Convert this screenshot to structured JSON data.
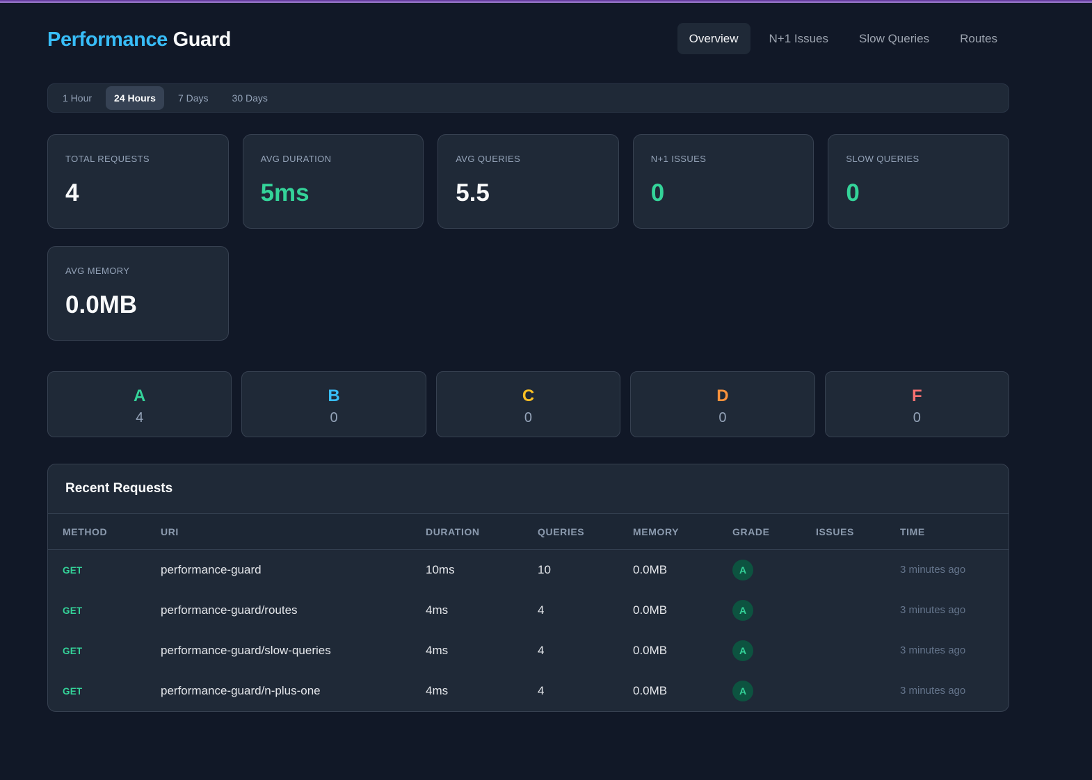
{
  "colors": {
    "page_bg": "#111827",
    "card_bg": "#1f2937",
    "card_border": "#374151",
    "blue": "#38bdf8",
    "green": "#34d399",
    "amber": "#fbbf24",
    "orange": "#fb923c",
    "red": "#f87171",
    "topbar_purple": "#8b5cf6"
  },
  "header": {
    "title_accent": "Performance",
    "title_rest": "Guard",
    "nav": [
      {
        "label": "Overview",
        "active": true
      },
      {
        "label": "N+1 Issues",
        "active": false
      },
      {
        "label": "Slow Queries",
        "active": false
      },
      {
        "label": "Routes",
        "active": false
      }
    ]
  },
  "time_range": [
    {
      "label": "1 Hour",
      "active": false
    },
    {
      "label": "24 Hours",
      "active": true
    },
    {
      "label": "7 Days",
      "active": false
    },
    {
      "label": "30 Days",
      "active": false
    }
  ],
  "stats": [
    {
      "label": "TOTAL REQUESTS",
      "value": "4",
      "color": "default"
    },
    {
      "label": "AVG DURATION",
      "value": "5ms",
      "color": "green"
    },
    {
      "label": "AVG QUERIES",
      "value": "5.5",
      "color": "default"
    },
    {
      "label": "N+1 ISSUES",
      "value": "0",
      "color": "green"
    },
    {
      "label": "SLOW QUERIES",
      "value": "0",
      "color": "green"
    },
    {
      "label": "AVG MEMORY",
      "value": "0.0MB",
      "color": "default"
    }
  ],
  "grades": [
    {
      "letter": "A",
      "count": "4",
      "color": "#34d399"
    },
    {
      "letter": "B",
      "count": "0",
      "color": "#38bdf8"
    },
    {
      "letter": "C",
      "count": "0",
      "color": "#fbbf24"
    },
    {
      "letter": "D",
      "count": "0",
      "color": "#fb923c"
    },
    {
      "letter": "F",
      "count": "0",
      "color": "#f87171"
    }
  ],
  "table": {
    "title": "Recent Requests",
    "columns": [
      "METHOD",
      "URI",
      "DURATION",
      "QUERIES",
      "MEMORY",
      "GRADE",
      "ISSUES",
      "TIME"
    ],
    "rows": [
      {
        "method": "GET",
        "uri": "performance-guard",
        "duration": "10ms",
        "queries": "10",
        "memory": "0.0MB",
        "grade": "A",
        "issues": "",
        "time": "3 minutes ago"
      },
      {
        "method": "GET",
        "uri": "performance-guard/routes",
        "duration": "4ms",
        "queries": "4",
        "memory": "0.0MB",
        "grade": "A",
        "issues": "",
        "time": "3 minutes ago"
      },
      {
        "method": "GET",
        "uri": "performance-guard/slow-queries",
        "duration": "4ms",
        "queries": "4",
        "memory": "0.0MB",
        "grade": "A",
        "issues": "",
        "time": "3 minutes ago"
      },
      {
        "method": "GET",
        "uri": "performance-guard/n-plus-one",
        "duration": "4ms",
        "queries": "4",
        "memory": "0.0MB",
        "grade": "A",
        "issues": "",
        "time": "3 minutes ago"
      }
    ]
  }
}
